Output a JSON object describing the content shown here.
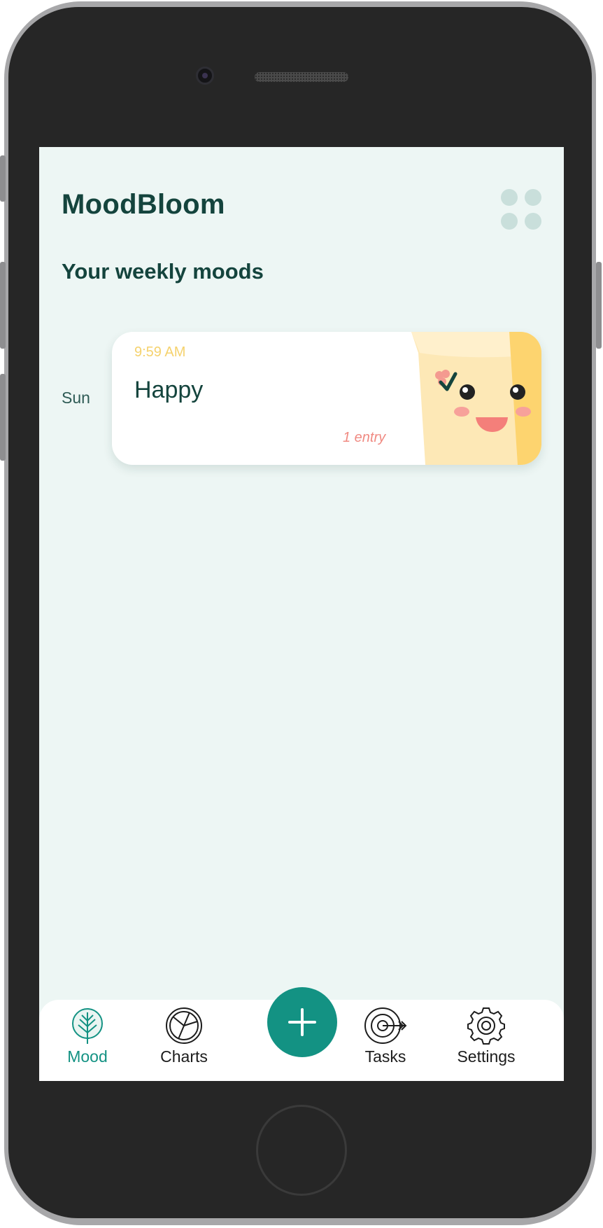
{
  "app": {
    "title": "MoodBloom",
    "section_title": "Your weekly moods"
  },
  "icons": {
    "menu": "grid-dots-icon",
    "fab": "plus-icon",
    "mood_tab": "leaf-icon",
    "charts_tab": "pie-chart-icon",
    "tasks_tab": "target-icon",
    "settings_tab": "gear-icon",
    "mood_art": "happy-face-illustration"
  },
  "week": [
    {
      "day": "Sun",
      "entry": {
        "time": "9:59 AM",
        "mood": "Happy",
        "entries_label": "1 entry"
      }
    }
  ],
  "nav": {
    "items": [
      {
        "label": "Mood",
        "active": true
      },
      {
        "label": "Charts",
        "active": false
      },
      {
        "label": "Tasks",
        "active": false
      },
      {
        "label": "Settings",
        "active": false
      }
    ]
  },
  "colors": {
    "background": "#edf6f4",
    "primary": "#139283",
    "heading": "#14443d",
    "time_text": "#f5d26e",
    "entries_text": "#f08a82",
    "card_art": "#fde8b6"
  }
}
